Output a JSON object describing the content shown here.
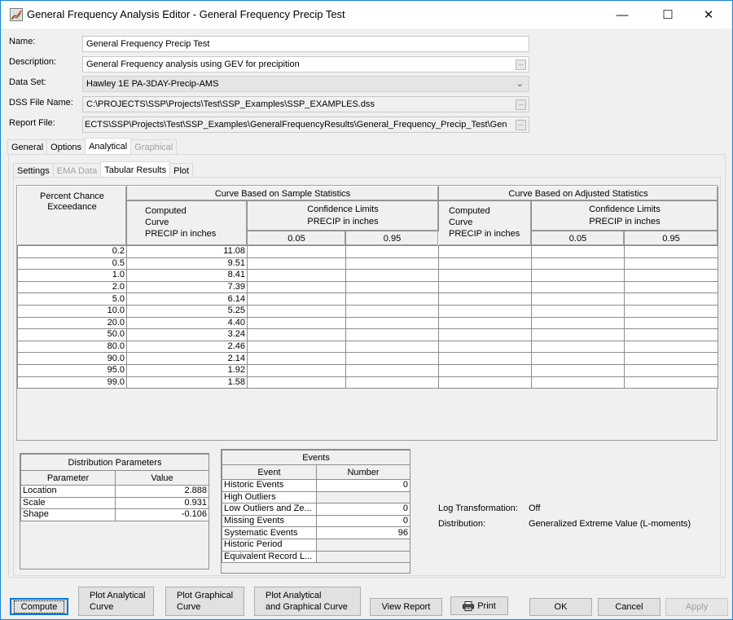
{
  "window": {
    "title": "General Frequency Analysis Editor - General Frequency Precip Test",
    "icon": "chart-icon",
    "controls": {
      "minimize": "—",
      "maximize": "☐",
      "close": "✕"
    }
  },
  "form": {
    "name_label": "Name:",
    "name_value": "General Frequency Precip Test",
    "description_label": "Description:",
    "description_value": "General Frequency analysis using GEV for precipition",
    "dataset_label": "Data Set:",
    "dataset_value": "Hawley 1E PA-3DAY-Precip-AMS",
    "dss_label": "DSS File Name:",
    "dss_value": "C:\\PROJECTS\\SSP\\Projects\\Test\\SSP_Examples\\SSP_EXAMPLES.dss",
    "report_label": "Report File:",
    "report_value": "ECTS\\SSP\\Projects\\Test\\SSP_Examples\\GeneralFrequencyResults\\General_Frequency_Precip_Test\\Gen",
    "ellipsis": "..."
  },
  "main_tabs": [
    {
      "label": "General",
      "state": "normal"
    },
    {
      "label": "Options",
      "state": "normal"
    },
    {
      "label": "Analytical",
      "state": "active"
    },
    {
      "label": "Graphical",
      "state": "disabled"
    }
  ],
  "sub_tabs": [
    {
      "label": "Settings",
      "state": "normal"
    },
    {
      "label": "EMA Data",
      "state": "disabled"
    },
    {
      "label": "Tabular Results",
      "state": "active"
    },
    {
      "label": "Plot",
      "state": "normal"
    }
  ],
  "results_table": {
    "col_pce": [
      "Percent Chance",
      "Exceedance"
    ],
    "group_sample": "Curve Based on Sample Statistics",
    "group_adjusted": "Curve Based on Adjusted Statistics",
    "computed": [
      "Computed",
      "Curve",
      "PRECIP in inches"
    ],
    "confidence": [
      "Confidence Limits",
      "PRECIP in inches"
    ],
    "limit_low": "0.05",
    "limit_high": "0.95",
    "rows": [
      {
        "pce": "0.2",
        "computed": "11.08"
      },
      {
        "pce": "0.5",
        "computed": "9.51"
      },
      {
        "pce": "1.0",
        "computed": "8.41"
      },
      {
        "pce": "2.0",
        "computed": "7.39"
      },
      {
        "pce": "5.0",
        "computed": "6.14"
      },
      {
        "pce": "10.0",
        "computed": "5.25"
      },
      {
        "pce": "20.0",
        "computed": "4.40"
      },
      {
        "pce": "50.0",
        "computed": "3.24"
      },
      {
        "pce": "80.0",
        "computed": "2.46"
      },
      {
        "pce": "90.0",
        "computed": "2.14"
      },
      {
        "pce": "95.0",
        "computed": "1.92"
      },
      {
        "pce": "99.0",
        "computed": "1.58"
      }
    ]
  },
  "distribution_parameters": {
    "title": "Distribution Parameters",
    "col_parameter": "Parameter",
    "col_value": "Value",
    "rows": [
      {
        "name": "Location",
        "value": "2.888"
      },
      {
        "name": "Scale",
        "value": "0.931"
      },
      {
        "name": "Shape",
        "value": "-0.106"
      }
    ]
  },
  "events": {
    "title": "Events",
    "col_event": "Event",
    "col_number": "Number",
    "rows": [
      {
        "name": "Historic Events",
        "value": "0"
      },
      {
        "name": "High Outliers",
        "value": ""
      },
      {
        "name": "Low Outliers and Ze...",
        "value": "0"
      },
      {
        "name": "Missing Events",
        "value": "0"
      },
      {
        "name": "Systematic Events",
        "value": "96"
      },
      {
        "name": "Historic Period",
        "value": ""
      },
      {
        "name": "Equivalent Record L...",
        "value": ""
      }
    ]
  },
  "info": {
    "log_label": "Log Transformation:",
    "log_value": "Off",
    "dist_label": "Distribution:",
    "dist_value": "Generalized Extreme Value (L-moments)"
  },
  "buttons": {
    "compute": "Compute",
    "plot_analytical": [
      "Plot Analytical",
      "Curve"
    ],
    "plot_graphical": [
      "Plot Graphical",
      "Curve"
    ],
    "plot_both": [
      "Plot Analytical",
      "and Graphical Curve"
    ],
    "view_report": "View Report",
    "print": "Print",
    "ok": "OK",
    "cancel": "Cancel",
    "apply": "Apply"
  }
}
